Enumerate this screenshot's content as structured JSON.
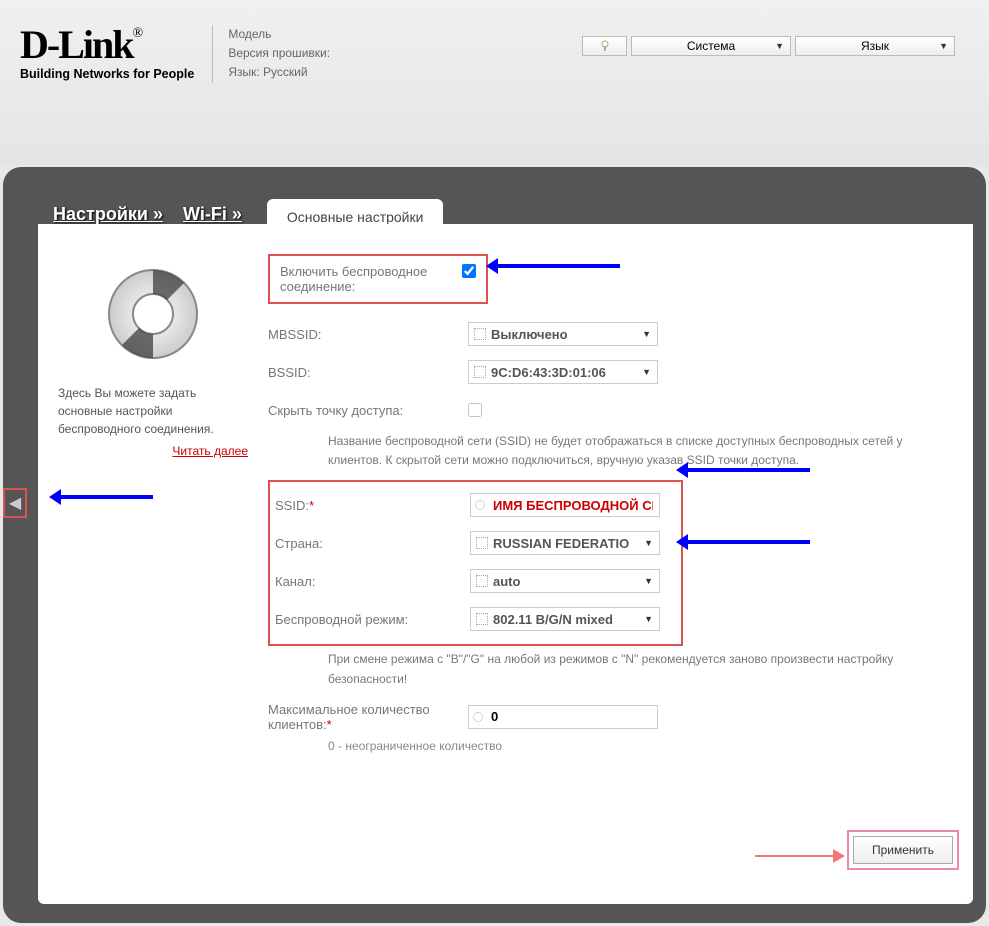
{
  "header": {
    "logo_title": "D-Link",
    "logo_sub": "Building Networks for People",
    "info": {
      "model": "Модель",
      "fw": "Версия прошивки:",
      "lang": "Язык: Русский"
    },
    "system_label": "Система",
    "lang_label": "Язык"
  },
  "breadcrumb": {
    "root": "Настройки »",
    "wifi": "Wi-Fi »",
    "tab": "Основные настройки"
  },
  "side": {
    "text": "Здесь Вы можете задать основные настройки беспроводного соединения.",
    "read_more": "Читать далее"
  },
  "form": {
    "enable_label": "Включить беспроводное соединение:",
    "enable_checked": true,
    "mbssid_label": "MBSSID:",
    "mbssid_value": "Выключено",
    "bssid_label": "BSSID:",
    "bssid_value": "9C:D6:43:3D:01:06",
    "hide_label": "Скрыть точку доступа:",
    "hide_note": "Название беспроводной сети (SSID) не будет отображаться в списке доступных беспроводных сетей у клиентов. К скрытой сети можно подключиться, вручную указав SSID точки доступа.",
    "ssid_label": "SSID:",
    "ssid_value": "ИМЯ БЕСПРОВОДНОЙ СЕТИ",
    "country_label": "Страна:",
    "country_value": "RUSSIAN FEDERATIO",
    "channel_label": "Канал:",
    "channel_value": "auto",
    "mode_label": "Беспроводной режим:",
    "mode_value": "802.11 B/G/N mixed",
    "mode_note": "При смене режима с \"B\"/\"G\" на любой из режимов с \"N\" рекомендуется заново произвести настройку безопасности!",
    "max_label": "Максимальное количество клиентов:",
    "max_value": "0",
    "max_note": "0 - неограниченное количество"
  },
  "apply_label": "Применить"
}
